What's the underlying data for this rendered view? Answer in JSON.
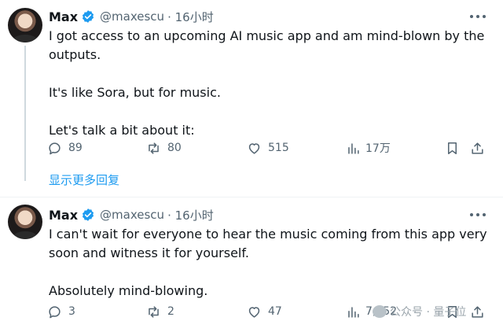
{
  "tweets": [
    {
      "name": "Max",
      "handle": "@maxescu",
      "time": "· 16小时",
      "paragraphs": [
        "I got access to an upcoming AI music app and am mind-blown by the outputs.",
        "It's like Sora, but for music.",
        "Let's talk a bit about it:"
      ],
      "replies": "89",
      "reposts": "80",
      "likes": "515",
      "views": "17万"
    },
    {
      "name": "Max",
      "handle": "@maxescu",
      "time": "· 16小时",
      "paragraphs": [
        "I can't wait for everyone to hear the music coming from this app very soon and witness it for yourself.",
        "Absolutely mind-blowing."
      ],
      "replies": "3",
      "reposts": "2",
      "likes": "47",
      "views": "7,852"
    }
  ],
  "show_more": "显示更多回复",
  "watermark": "公众号 · 量子位",
  "colors": {
    "accent": "#1d9bf0",
    "text": "#0f1419",
    "muted": "#536471"
  }
}
